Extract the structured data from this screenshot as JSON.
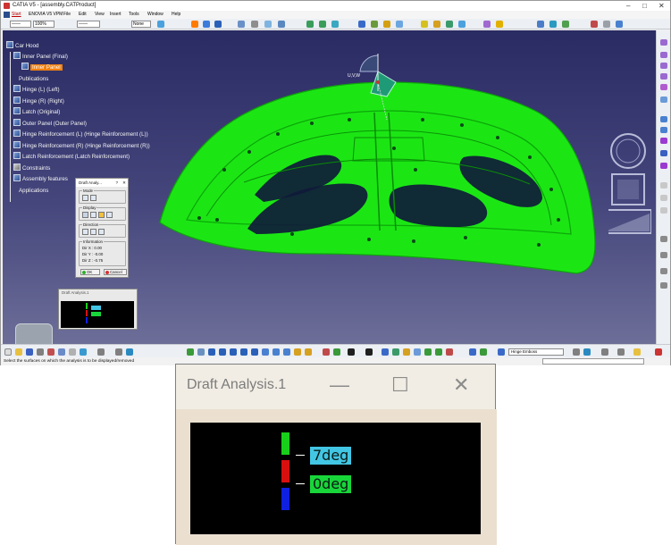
{
  "window": {
    "title": "CATIA V5 - [assembly.CATProduct]",
    "minimize": "–",
    "maximize": "□",
    "close": "✕"
  },
  "menu": [
    "Start",
    "ENOVIA V5 VPM",
    "File",
    "Edit",
    "View",
    "Insert",
    "Tools",
    "Window",
    "Help"
  ],
  "toolbar": {
    "style_combo": "——",
    "zoom_combo": "100%",
    "line_combo": "——",
    "none_combo": "None"
  },
  "tree": {
    "root": "Car Hood",
    "items": [
      {
        "label": "Inner Panel (Final)",
        "indent": 1
      },
      {
        "label": "Inner Panel",
        "indent": 2,
        "selected": true
      },
      {
        "label": "Publications",
        "indent": 1
      },
      {
        "label": "Hinge (L) (Left)",
        "indent": 1
      },
      {
        "label": "Hinge (R) (Right)",
        "indent": 1
      },
      {
        "label": "Latch (Original)",
        "indent": 1
      },
      {
        "label": "Outer Panel (Outer Panel)",
        "indent": 1
      },
      {
        "label": "Hinge Reinforcement (L) (Hinge Reinforcement (L))",
        "indent": 1
      },
      {
        "label": "Hinge Reinforcement (R) (Hinge Reinforcement (R))",
        "indent": 1
      },
      {
        "label": "Latch Reinforcement (Latch Reinforcement)",
        "indent": 1
      },
      {
        "label": "Constraints",
        "indent": 1
      },
      {
        "label": "Assembly features",
        "indent": 1
      },
      {
        "label": "Applications",
        "indent": 1
      }
    ]
  },
  "compass_label": "U,V,W",
  "dialog": {
    "title": "Draft Analy...",
    "help": "?",
    "close": "✕",
    "mode_label": "Mode",
    "display_label": "Display",
    "direction_label": "Direction",
    "information_label": "Information",
    "dx": "Dir X : 0.00",
    "dy": "Dir Y : -0.00",
    "dz": "Dir Z : -0.75",
    "ok": "OK",
    "cancel": "Cancel"
  },
  "small_window": {
    "title": "Draft Analysis.1"
  },
  "bottom_combo": "Hinge Emboss",
  "status": "Select the surfaces on which the analysis is to be displayed/removed",
  "zoom_panel": {
    "title": "Draft Analysis.1",
    "minimize": "—",
    "maximize": "☐",
    "close": "✕",
    "label_top": "7deg",
    "label_bottom": "0deg"
  },
  "colors": {
    "panel_green": "#1be614",
    "selected_orange": "#f08010",
    "legend_green": "#18d01a",
    "legend_red": "#d80f0f",
    "legend_blue": "#1020e0",
    "label_cyan": "#42c6e4",
    "label_green": "#18d63a"
  }
}
